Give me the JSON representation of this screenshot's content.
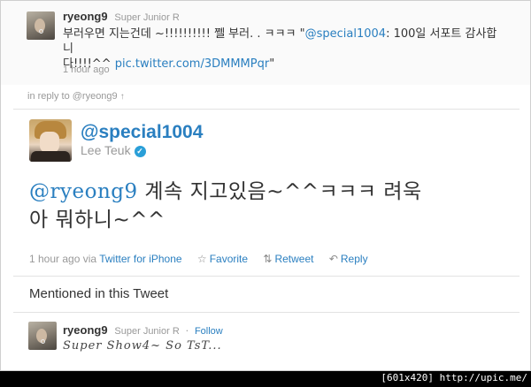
{
  "top_tweet": {
    "username": "ryeong9",
    "full_name": "Super Junior R",
    "text_line1": "부러우면 지는건데 ~!!!!!!!!!! 쩰 부러. . ㅋㅋㅋ \"",
    "text_mention": "@special1004",
    "text_line1_rest": ": 100일 서포트 감사합니",
    "text_line2": "다!!!!^^ ",
    "text_link": "pic.twitter.com/3DMMMPqr",
    "text_end": "\"",
    "time": "1 hour ago"
  },
  "reply_context": {
    "text": "in reply to @ryeong9",
    "arrow": "↑"
  },
  "main_tweet": {
    "handle": "@special1004",
    "name": "Lee Teuk",
    "verified_mark": "✓",
    "mention": "@ryeong9",
    "text_line1": " 계속 지고있음~^^ㅋㅋㅋ 려욱",
    "text_line2": "아 뭐하니~^^",
    "time": "1 hour ago",
    "via_label": "via",
    "via_app": "Twitter for iPhone",
    "favorite_icon": "☆",
    "favorite_label": "Favorite",
    "retweet_icon": "⇅",
    "retweet_label": "Retweet",
    "reply_icon": "↶",
    "reply_label": "Reply"
  },
  "mentioned": {
    "title": "Mentioned in this Tweet",
    "username": "ryeong9",
    "full_name": "Super Junior R",
    "separator": "·",
    "follow_label": "Follow",
    "bio": "Super Show4~ So TsT..."
  },
  "watermark": "[601x420] http://upic.me/",
  "colors": {
    "link": "#2a7fc0",
    "muted": "#999999",
    "text": "#333333"
  }
}
